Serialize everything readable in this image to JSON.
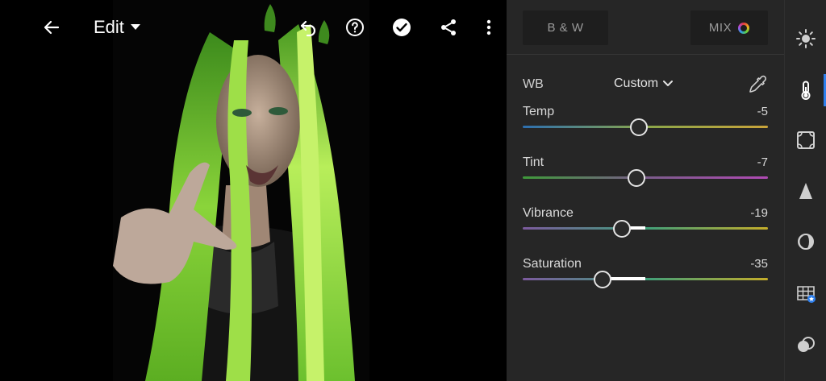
{
  "header": {
    "back_icon": "arrow-left-icon",
    "mode_label": "Edit",
    "icons": [
      "undo-icon",
      "help-icon",
      "check-icon",
      "share-icon",
      "more-vertical-icon"
    ]
  },
  "panel": {
    "bw_label": "B & W",
    "mix_label": "MIX",
    "wb": {
      "label": "WB",
      "value": "Custom"
    },
    "sliders": [
      {
        "name": "Temp",
        "value": "-5",
        "numeric": -5,
        "gradient": [
          "#2d6fb0",
          "#8aa64a",
          "#c9a43a"
        ]
      },
      {
        "name": "Tint",
        "value": "-7",
        "numeric": -7,
        "gradient": [
          "#3f9a3a",
          "#7a5c8a",
          "#b04ab4"
        ]
      },
      {
        "name": "Vibrance",
        "value": "-19",
        "numeric": -19,
        "gradient": [
          "#7c5a9e",
          "#3f9f7a",
          "#c4ad2a"
        ]
      },
      {
        "name": "Saturation",
        "value": "-35",
        "numeric": -35,
        "gradient": [
          "#7c5a9e",
          "#3f9f7a",
          "#c4ad2a"
        ]
      }
    ]
  },
  "rail": {
    "items": [
      "light-icon",
      "color-icon",
      "effects-icon",
      "detail-icon",
      "optics-icon",
      "geometry-icon",
      "presets-icon"
    ],
    "active": "color-icon"
  },
  "colors": {
    "accent": "#2f80ed",
    "panel": "#262626",
    "chip": "#1e1e1e"
  }
}
